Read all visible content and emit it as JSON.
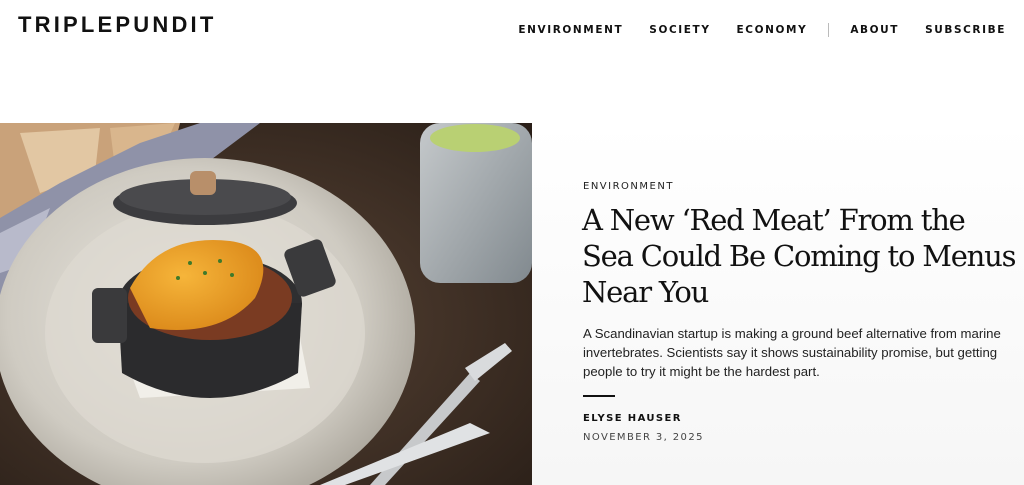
{
  "header": {
    "logo": "TRIPLEPUNDIT",
    "nav": [
      "ENVIRONMENT",
      "SOCIETY",
      "ECONOMY",
      "ABOUT",
      "SUBSCRIBE"
    ]
  },
  "article": {
    "category": "ENVIRONMENT",
    "title": "A New ‘Red Meat’ From the Sea Could Be Coming to Menus Near You",
    "dek": "A Scandinavian startup is making a ground beef alternative from marine invertebrates. Scientists say it shows sustainability promise, but getting people to try it might be the hardest part.",
    "author": "ELYSE HAUSER",
    "date": "NOVEMBER 3, 2025"
  },
  "colors": {
    "text": "#111111",
    "panel_bg": "#f6f6f6"
  }
}
